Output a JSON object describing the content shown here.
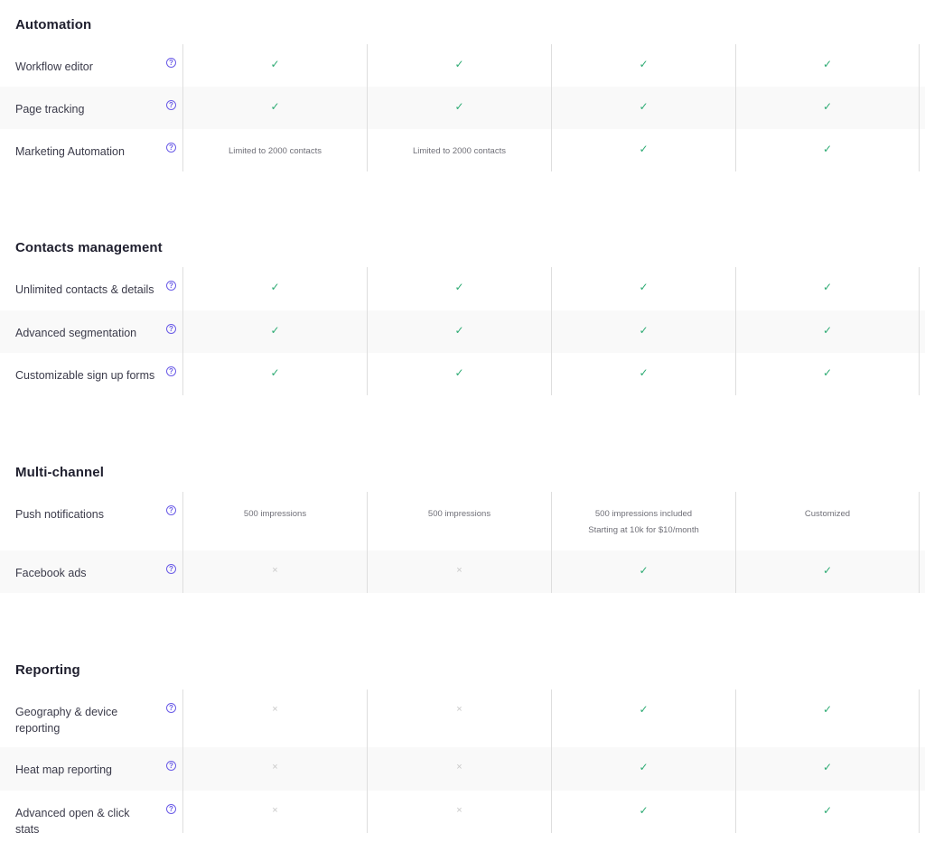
{
  "colors": {
    "accent": "#6b5ce7",
    "check": "#2dab73",
    "cross": "#c8c8c8",
    "row_alt_bg": "#f9f9f9",
    "divider": "#dedede"
  },
  "icons": {
    "help": "question-circle-icon",
    "included": "check-icon",
    "not_included": "cross-icon"
  },
  "glyphs": {
    "help": "?",
    "check": "✓",
    "cross": "×"
  },
  "sections": [
    {
      "title": "Automation",
      "rows": [
        {
          "label": "Workflow editor",
          "values": [
            {
              "type": "check"
            },
            {
              "type": "check"
            },
            {
              "type": "check"
            },
            {
              "type": "check"
            }
          ]
        },
        {
          "label": "Page tracking",
          "values": [
            {
              "type": "check"
            },
            {
              "type": "check"
            },
            {
              "type": "check"
            },
            {
              "type": "check"
            }
          ]
        },
        {
          "label": "Marketing Automation",
          "values": [
            {
              "type": "text",
              "lines": [
                "Limited to 2000 contacts"
              ]
            },
            {
              "type": "text",
              "lines": [
                "Limited to 2000 contacts"
              ]
            },
            {
              "type": "check"
            },
            {
              "type": "check"
            }
          ]
        }
      ]
    },
    {
      "title": "Contacts management",
      "rows": [
        {
          "label": "Unlimited contacts & details",
          "values": [
            {
              "type": "check"
            },
            {
              "type": "check"
            },
            {
              "type": "check"
            },
            {
              "type": "check"
            }
          ]
        },
        {
          "label": "Advanced segmentation",
          "values": [
            {
              "type": "check"
            },
            {
              "type": "check"
            },
            {
              "type": "check"
            },
            {
              "type": "check"
            }
          ]
        },
        {
          "label": "Customizable sign up forms",
          "values": [
            {
              "type": "check"
            },
            {
              "type": "check"
            },
            {
              "type": "check"
            },
            {
              "type": "check"
            }
          ]
        }
      ]
    },
    {
      "title": "Multi-channel",
      "rows": [
        {
          "label": "Push notifications",
          "values": [
            {
              "type": "text",
              "lines": [
                "500 impressions"
              ]
            },
            {
              "type": "text",
              "lines": [
                "500 impressions"
              ]
            },
            {
              "type": "text",
              "lines": [
                "500 impressions included",
                "Starting at 10k for $10/month"
              ]
            },
            {
              "type": "text",
              "lines": [
                "Customized"
              ]
            }
          ]
        },
        {
          "label": "Facebook ads",
          "values": [
            {
              "type": "cross"
            },
            {
              "type": "cross"
            },
            {
              "type": "check"
            },
            {
              "type": "check"
            }
          ]
        }
      ]
    },
    {
      "title": "Reporting",
      "rows": [
        {
          "label": "Geography & device reporting",
          "values": [
            {
              "type": "cross"
            },
            {
              "type": "cross"
            },
            {
              "type": "check"
            },
            {
              "type": "check"
            }
          ]
        },
        {
          "label": "Heat map reporting",
          "values": [
            {
              "type": "cross"
            },
            {
              "type": "cross"
            },
            {
              "type": "check"
            },
            {
              "type": "check"
            }
          ]
        },
        {
          "label": "Advanced open & click stats",
          "values": [
            {
              "type": "cross"
            },
            {
              "type": "cross"
            },
            {
              "type": "check"
            },
            {
              "type": "check"
            }
          ]
        }
      ]
    }
  ]
}
